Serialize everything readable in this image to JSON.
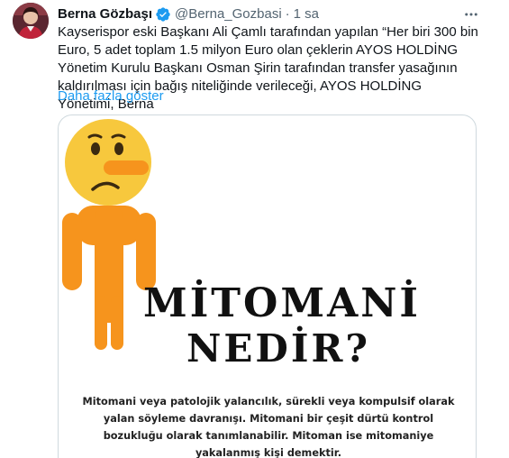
{
  "tweet": {
    "author_name": "Berna Gözbaşı",
    "handle": "@Berna_Gozbasi",
    "separator": "·",
    "time": "1 sa",
    "text": "Kayserispor eski Başkanı Ali Çamlı tarafından yapılan “Her biri 300 bin Euro, 5 adet toplam 1.5 milyon Euro olan çeklerin AYOS HOLDİNG Yönetim Kurulu Başkanı Osman Şirin tarafından transfer yasağının kaldırılması için bağış niteliğinde verileceği, AYOS HOLDİNG Yönetimi, Berna",
    "show_more": "Daha fazla göster"
  },
  "media": {
    "title_line1": "MİTOMANİ",
    "title_line2": "NEDİR?",
    "description": "Mitomani veya patolojik yalancılık, sürekli veya kompulsif olarak yalan söyleme davranışı.  Mitomani bir çeşit dürtü kontrol bozukluğu olarak tanımlanabilir. Mitoman ise mitomaniye yakalanmış kişi demektir.",
    "colors": {
      "face": "#f7c83d",
      "body": "#f6941d",
      "nose": "#f6941d"
    }
  },
  "colors": {
    "verified": "#1d9bf0",
    "link": "#1d9bf0",
    "secondary_text": "#536471",
    "border": "#cfd9de"
  },
  "icons": {
    "verified": "verified-badge-icon",
    "more": "more-horizontal-icon"
  }
}
